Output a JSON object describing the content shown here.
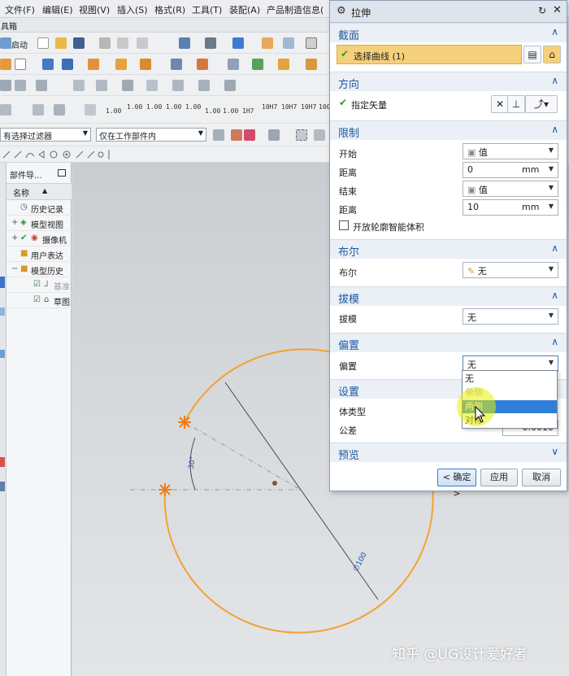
{
  "menu": [
    "文件(F)",
    "编辑(E)",
    "视图(V)",
    "插入(S)",
    "格式(R)",
    "工具(T)",
    "装配(A)",
    "产品制造信息("
  ],
  "toolbox_label": "具箱",
  "toolbar": {
    "start_label": "启动",
    "number_buttons": [
      "1.00",
      "1.00",
      "1.00",
      "1.00",
      "1.00",
      "1.00",
      "1.00",
      "1.00",
      "1H7",
      "10H7",
      "10H7",
      "10H7",
      "100"
    ],
    "filter_select": "有选择过滤器",
    "scope_select": "仅在工作部件内"
  },
  "nav": {
    "title": "部件导...",
    "column_name": "名称",
    "items": [
      "历史记录",
      "模型视图",
      "摄像机",
      "用户表达",
      "模型历史",
      "基准",
      "草图"
    ]
  },
  "canvas": {
    "angle_label": "30°",
    "diameter_label": "∅100",
    "colors": {
      "curve": "#f4a133",
      "dimension": "#4a4a4a",
      "point": "#f07d1a"
    }
  },
  "dialog": {
    "title": "拉伸",
    "sections": {
      "section": {
        "title": "截面",
        "select_curve": "选择曲线 (1)"
      },
      "direction": {
        "title": "方向",
        "specify_vector": "指定矢量"
      },
      "limits": {
        "title": "限制",
        "start_label": "开始",
        "start_value": "值",
        "distance1_label": "距离",
        "distance1_value": "0",
        "distance1_unit": "mm",
        "end_label": "结束",
        "end_value": "值",
        "distance2_label": "距离",
        "distance2_value": "10",
        "distance2_unit": "mm",
        "open_profile": "开放轮廓智能体积"
      },
      "boolean": {
        "title": "布尔",
        "label": "布尔",
        "value": "无"
      },
      "draft": {
        "title": "拔模",
        "label": "拔模",
        "value": "无"
      },
      "offset": {
        "title": "偏置",
        "label": "偏置",
        "value": "无",
        "options": [
          "无",
          "单侧",
          "两侧",
          "对称"
        ],
        "highlighted": "两侧"
      },
      "settings": {
        "title": "设置",
        "body_type_label": "体类型",
        "tolerance_label": "公差",
        "tolerance_value": "0.0010"
      },
      "preview": {
        "title": "预览"
      }
    },
    "buttons": {
      "ok": "< 确定 >",
      "apply": "应用",
      "cancel": "取消"
    },
    "colors": {
      "accent": "#1d5aa0",
      "selected_row": "#f5d07a",
      "highlight_option": "#2f7fd8",
      "cursor_halo": "#e9f000"
    }
  },
  "watermark": "知乎 @UG设计爱好者"
}
